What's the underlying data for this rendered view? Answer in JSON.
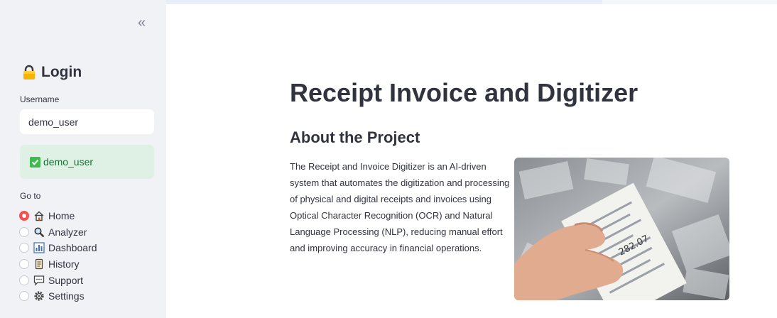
{
  "sidebar": {
    "collapse_glyph": "«",
    "login_title": "Login",
    "username_label": "Username",
    "username_value": "demo_user",
    "success_text": "demo_user",
    "goto_label": "Go to",
    "nav": [
      {
        "label": "Home",
        "icon": "home-icon",
        "selected": true
      },
      {
        "label": "Analyzer",
        "icon": "magnifier-icon",
        "selected": false
      },
      {
        "label": "Dashboard",
        "icon": "bar-chart-icon",
        "selected": false
      },
      {
        "label": "History",
        "icon": "scroll-icon",
        "selected": false
      },
      {
        "label": "Support",
        "icon": "speech-bubble-icon",
        "selected": false
      },
      {
        "label": "Settings",
        "icon": "gear-icon",
        "selected": false
      }
    ]
  },
  "main": {
    "title": "Receipt Invoice and Digitizer",
    "subtitle": "About the Project",
    "description": "The Receipt and Invoice Digitizer is an AI-driven system that automates the digitization and processing of physical and digital receipts and invoices using Optical Character Recognition (OCR) and Natural Language Processing (NLP), reducing manual effort and improving accuracy in financial operations.",
    "photo_receipt_text": "282.07"
  },
  "colors": {
    "sidebar_bg": "#f0f2f6",
    "accent": "#ff4b4b",
    "success_bg": "#dff0e4",
    "success_text": "#177233"
  }
}
